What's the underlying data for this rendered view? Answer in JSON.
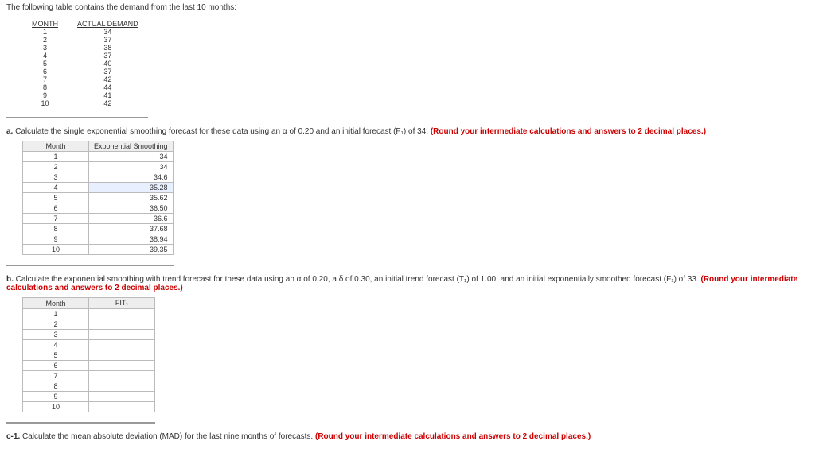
{
  "intro": "The following table contains the demand from the last 10 months:",
  "table1": {
    "headers": [
      "MONTH",
      "ACTUAL DEMAND"
    ],
    "rows": [
      {
        "month": "1",
        "demand": "34"
      },
      {
        "month": "2",
        "demand": "37"
      },
      {
        "month": "3",
        "demand": "38"
      },
      {
        "month": "4",
        "demand": "37"
      },
      {
        "month": "5",
        "demand": "40"
      },
      {
        "month": "6",
        "demand": "37"
      },
      {
        "month": "7",
        "demand": "42"
      },
      {
        "month": "8",
        "demand": "44"
      },
      {
        "month": "9",
        "demand": "41"
      },
      {
        "month": "10",
        "demand": "42"
      }
    ]
  },
  "qa": {
    "prefix": "a. ",
    "text": "Calculate the single exponential smoothing forecast for these data using an α of 0.20 and an initial forecast (F₁) of 34. ",
    "bold": "(Round your intermediate calculations and answers to 2 decimal places.)"
  },
  "table2": {
    "headers": [
      "Month",
      "Exponential Smoothing"
    ],
    "rows": [
      {
        "month": "1",
        "val": "34"
      },
      {
        "month": "2",
        "val": "34"
      },
      {
        "month": "3",
        "val": "34.6"
      },
      {
        "month": "4",
        "val": "35.28"
      },
      {
        "month": "5",
        "val": "35.62"
      },
      {
        "month": "6",
        "val": "36.50"
      },
      {
        "month": "7",
        "val": "36.6"
      },
      {
        "month": "8",
        "val": "37.68"
      },
      {
        "month": "9",
        "val": "38.94"
      },
      {
        "month": "10",
        "val": "39.35"
      }
    ]
  },
  "qb": {
    "prefix": "b. ",
    "text": "Calculate the exponential smoothing with trend forecast for these data using an α of 0.20, a δ of 0.30, an initial trend forecast (T₁) of 1.00, and an initial exponentially smoothed forecast (F₁) of 33. ",
    "bold": "(Round your intermediate calculations and answers to 2 decimal places.)"
  },
  "table3": {
    "headers": [
      "Month",
      "FITₜ"
    ],
    "rows": [
      {
        "month": "1",
        "val": ""
      },
      {
        "month": "2",
        "val": ""
      },
      {
        "month": "3",
        "val": ""
      },
      {
        "month": "4",
        "val": ""
      },
      {
        "month": "5",
        "val": ""
      },
      {
        "month": "6",
        "val": ""
      },
      {
        "month": "7",
        "val": ""
      },
      {
        "month": "8",
        "val": ""
      },
      {
        "month": "9",
        "val": ""
      },
      {
        "month": "10",
        "val": ""
      }
    ]
  },
  "qc": {
    "prefix": "c-1. ",
    "text": "Calculate the mean absolute deviation (MAD) for the last nine months of forecasts. ",
    "bold": "(Round your intermediate calculations and answers to 2 decimal places.)"
  }
}
